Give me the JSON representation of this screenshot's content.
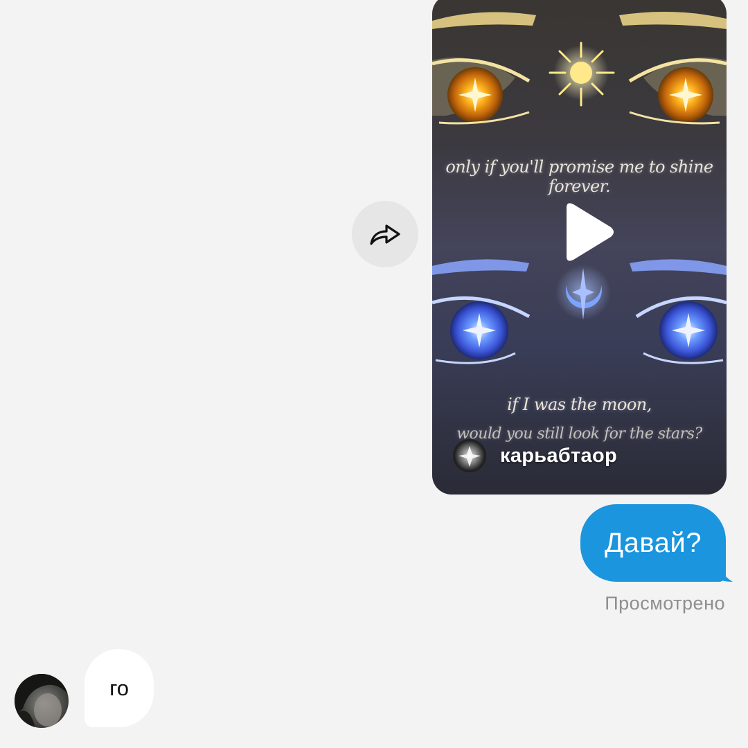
{
  "video": {
    "caption_top": "only if you'll promise me to shine forever.",
    "caption_moon_line1": "if I was the moon,",
    "caption_moon_line2": "would you still look for the stars?",
    "author_name": "карьабтаор"
  },
  "icons": {
    "share": "share-arrow-icon",
    "play": "play-icon"
  },
  "messages": {
    "outgoing_text": "Давай?",
    "seen_status": "Просмотрено",
    "incoming_text": "го"
  },
  "colors": {
    "outgoing_bubble": "#1a95de",
    "incoming_bubble": "#ffffff",
    "background": "#f3f3f3",
    "status_text": "#8e8e8e"
  }
}
